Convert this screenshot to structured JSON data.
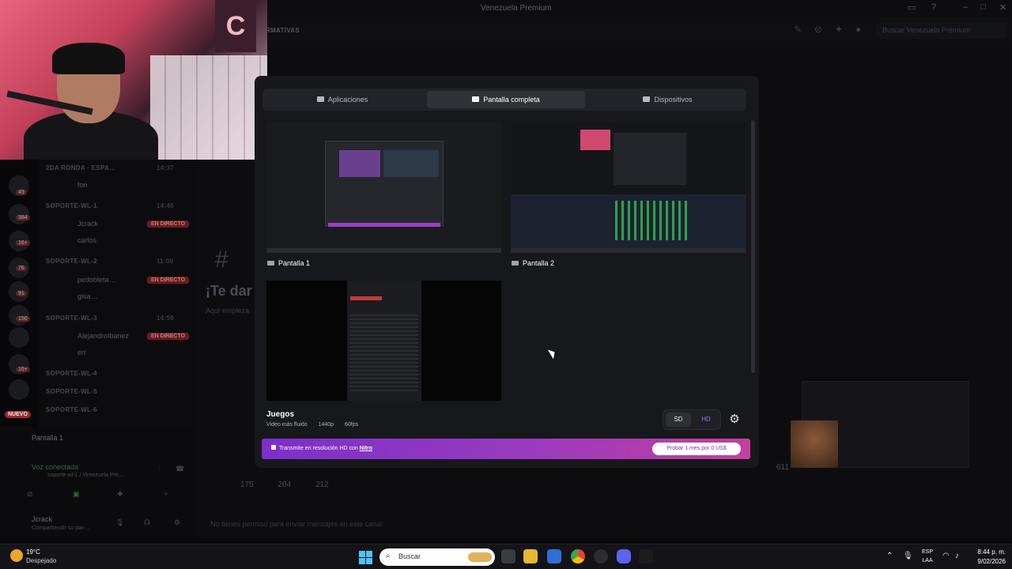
{
  "window": {
    "title": "Venezuela Premium"
  },
  "topbar": {
    "channel_fragment": "RMATIVAS",
    "search_placeholder": "Buscar Venezuela Premium"
  },
  "server_rail": {
    "new_badge": "NUEVO",
    "badges": [
      "49",
      "384",
      "16+",
      "76",
      "91",
      "150",
      "16+"
    ]
  },
  "channels": {
    "rows": [
      {
        "name": "2DA RONDA · ESPA…",
        "time": "14:37"
      },
      {
        "name": "SOPORTE-WL-1",
        "time": "14:45"
      },
      {
        "name": "SOPORTE-WL-2",
        "time": "11:00"
      },
      {
        "name": "SOPORTE-WL-3",
        "time": "14:56"
      },
      {
        "name": "SOPORTE-WL-4",
        "time": ""
      },
      {
        "name": "SOPORTE-WL-5",
        "time": ""
      },
      {
        "name": "SOPORTE-WL-6",
        "time": ""
      }
    ],
    "users": [
      "fon",
      "Jcrack",
      "carlos",
      "pedobleta…",
      "gisa…",
      "AlejandroIbanez",
      "err"
    ],
    "live_label": "EN DIRECTO"
  },
  "voice_panel": {
    "stream_title": "Pantalla 1",
    "voice_status": "Voz conectada",
    "voice_channel": "soporte-wl-1 / Venezuela Pre…",
    "username": "Jcrack",
    "user_status": "Compartiendo su pan…"
  },
  "chat": {
    "welcome": "¡Te dar",
    "sub": "Aquí empieza",
    "reactions": [
      "175",
      "204",
      "212"
    ],
    "count": "611",
    "no_permission": "No tienes permiso para enviar mensajes en este canal."
  },
  "modal": {
    "tabs": [
      {
        "label": "Aplicaciones",
        "active": false
      },
      {
        "label": "Pantalla completa",
        "active": true
      },
      {
        "label": "Dispositivos",
        "active": false
      }
    ],
    "screens": [
      {
        "label": "Pantalla 1"
      },
      {
        "label": "Pantalla 2"
      }
    ],
    "games": {
      "title": "Juegos",
      "subtitle": "Video más fluido",
      "resolution": "1440p",
      "fps": "60fps"
    },
    "quality": {
      "sd": "SD",
      "hd": "HD",
      "selected": "SD"
    },
    "nitro": {
      "text": "Transmite en resolución HD con",
      "link": "Nitro",
      "cta": "Probar 1 mes por 0 US$"
    }
  },
  "taskbar": {
    "weather_temp": "19°C",
    "weather_desc": "Despejado",
    "search_placeholder": "Buscar",
    "lang_line1": "ESP",
    "lang_line2": "LAA",
    "time": "8:44 p. m.",
    "date": "9/02/2026"
  },
  "colors": {
    "accent": "#5865f2",
    "nitro_start": "#7b2fc9",
    "nitro_end": "#c33f9f",
    "live": "#8a1e22"
  }
}
